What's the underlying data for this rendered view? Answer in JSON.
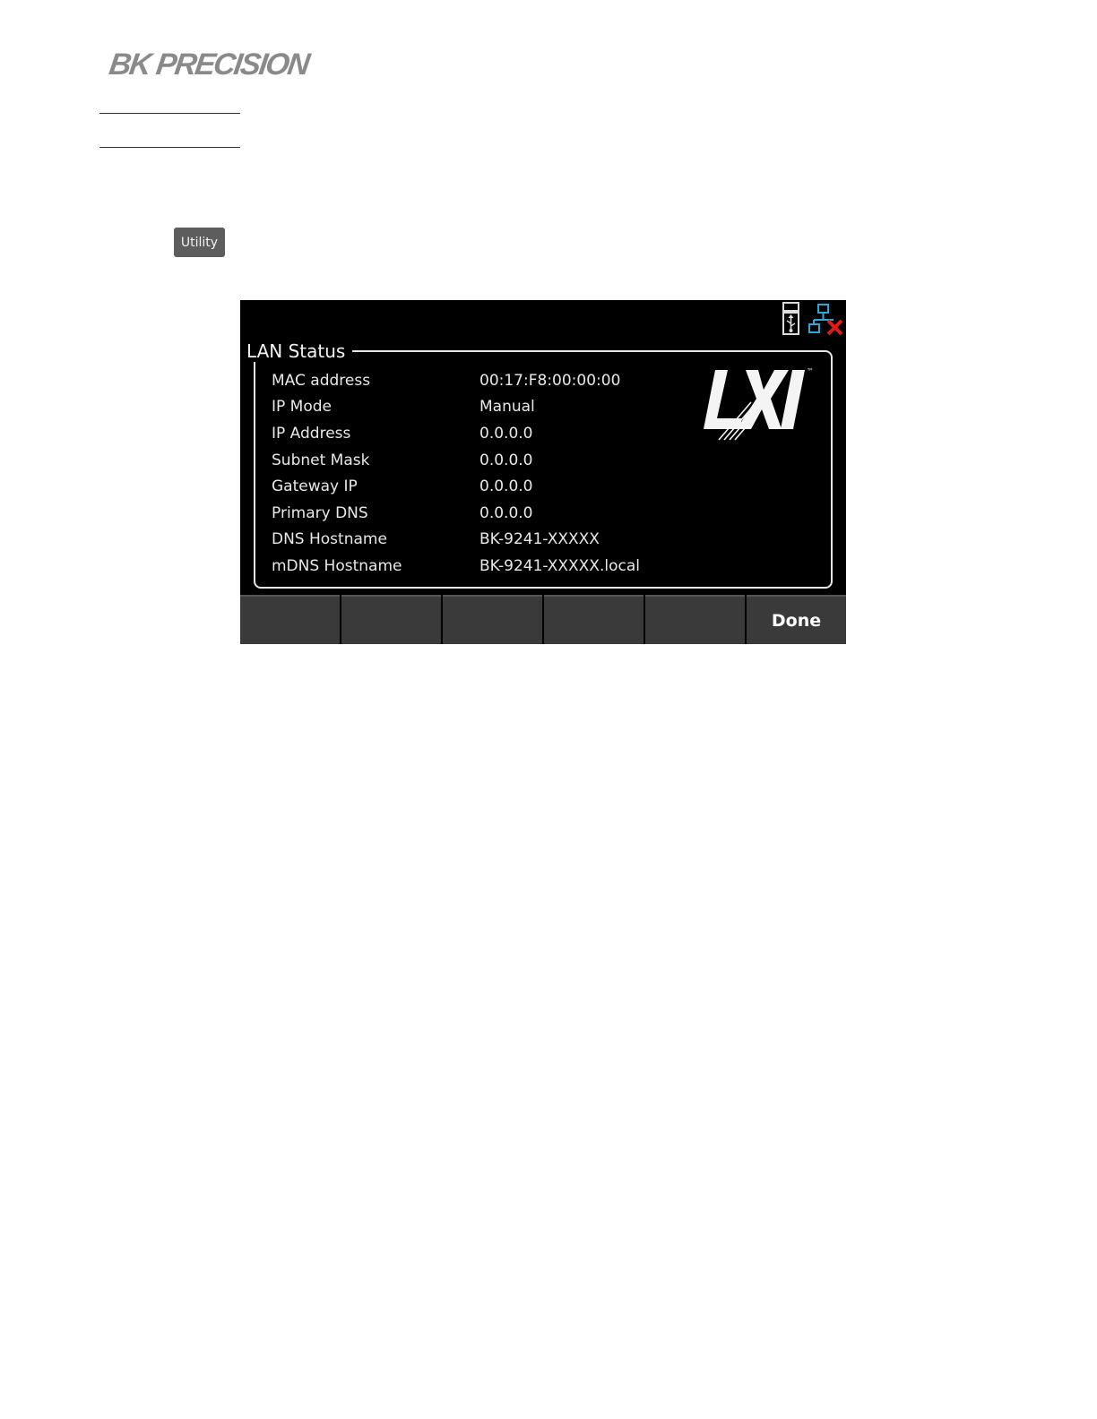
{
  "header": {
    "brand": "BK PRECISION"
  },
  "key": {
    "label": "Utility"
  },
  "screen": {
    "title": "LAN Status",
    "icons": [
      "usb-icon",
      "lan-disconnected-icon"
    ],
    "logo": "LXI",
    "logo_tm": "™",
    "rows": [
      {
        "label": "MAC address",
        "value": "00:17:F8:00:00:00"
      },
      {
        "label": "IP Mode",
        "value": "Manual"
      },
      {
        "label": "IP Address",
        "value": "0.0.0.0"
      },
      {
        "label": "Subnet Mask",
        "value": "0.0.0.0"
      },
      {
        "label": "Gateway IP",
        "value": "0.0.0.0"
      },
      {
        "label": "Primary DNS",
        "value": "0.0.0.0"
      },
      {
        "label": "DNS Hostname",
        "value": "BK-9241-XXXXX"
      },
      {
        "label": "mDNS Hostname",
        "value": "BK-9241-XXXXX.local"
      }
    ],
    "softkeys": [
      "",
      "",
      "",
      "",
      "",
      "Done"
    ]
  },
  "colors": {
    "screen_bg": "#000000",
    "text": "#e8e8e8",
    "softkey_bg": "#3a3a3a",
    "key_bg": "#5d5d5d",
    "lan_icon": "#2aa7d6",
    "lan_x": "#e01b1b"
  }
}
